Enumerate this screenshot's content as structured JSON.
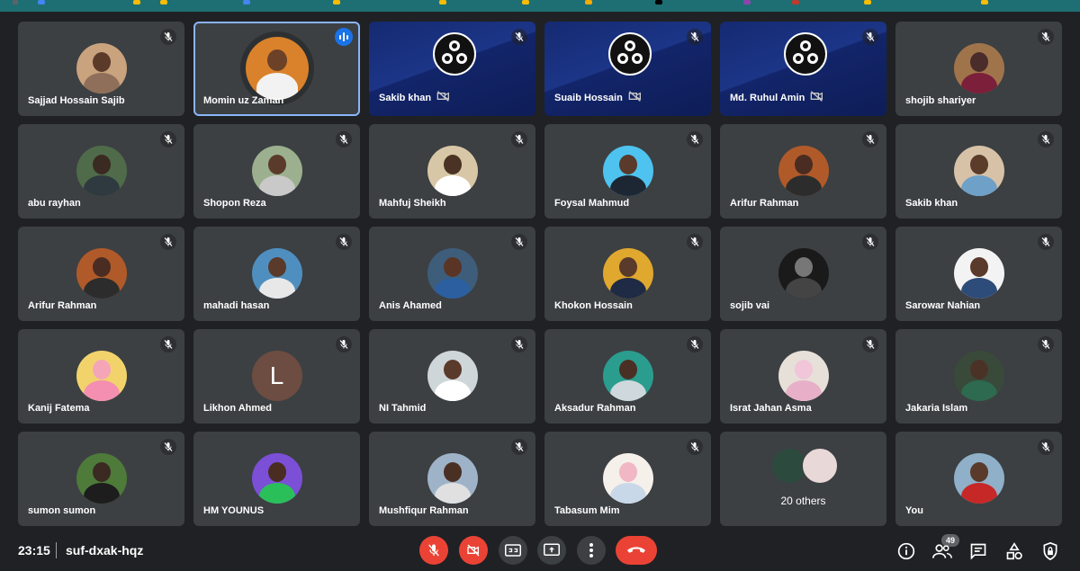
{
  "participants": [
    {
      "name": "Sajjad Hossain Sajib",
      "type": "photo",
      "bg": "#c9a27e",
      "head": "#5b3a2a",
      "body": "#8f6f5a",
      "muted": true
    },
    {
      "name": "Momin uz Zaman",
      "type": "photo-big",
      "bg": "#d9822b",
      "head": "#6b4227",
      "body": "#f2f2f2",
      "muted": false,
      "speaking": true,
      "active": true
    },
    {
      "name": "Sakib khan",
      "type": "obs",
      "muted": true,
      "cam_off": true
    },
    {
      "name": "Suaib Hossain",
      "type": "obs",
      "muted": true,
      "cam_off": true
    },
    {
      "name": "Md. Ruhul Amin",
      "type": "obs",
      "muted": true,
      "cam_off": true
    },
    {
      "name": "shojib shariyer",
      "type": "photo",
      "bg": "#a0744b",
      "head": "#4a2c2a",
      "body": "#7b1f3a",
      "muted": true
    },
    {
      "name": "abu rayhan",
      "type": "photo",
      "bg": "#4f6b4a",
      "head": "#3a2a22",
      "body": "#2e3a3f",
      "muted": true
    },
    {
      "name": "Shopon Reza",
      "type": "photo",
      "bg": "#9cb08f",
      "head": "#5a3b2a",
      "body": "#c9c9c9",
      "muted": true
    },
    {
      "name": "Mahfuj Sheikh",
      "type": "photo",
      "bg": "#d8c7a6",
      "head": "#4a3324",
      "body": "#ffffff",
      "muted": true
    },
    {
      "name": "Foysal Mahmud",
      "type": "photo",
      "bg": "#4ec3f0",
      "head": "#5a3a2a",
      "body": "#1d2733",
      "muted": true
    },
    {
      "name": "Arifur Rahman",
      "type": "photo",
      "bg": "#b05a2a",
      "head": "#4a2c22",
      "body": "#2c2c2c",
      "muted": true
    },
    {
      "name": "Sakib khan",
      "type": "photo",
      "bg": "#d7c2a8",
      "head": "#5b3b2a",
      "body": "#6fa0c8",
      "muted": true
    },
    {
      "name": "Arifur Rahman",
      "type": "photo",
      "bg": "#b05a2a",
      "head": "#4a2c22",
      "body": "#2c2c2c",
      "muted": true
    },
    {
      "name": "mahadi hasan",
      "type": "photo",
      "bg": "#4f8fc0",
      "head": "#5a3a2a",
      "body": "#e8e8e8",
      "muted": true
    },
    {
      "name": "Anis Ahamed",
      "type": "photo",
      "bg": "#3e5d7a",
      "head": "#5a3526",
      "body": "#2b5fa0",
      "muted": true
    },
    {
      "name": "Khokon Hossain",
      "type": "photo",
      "bg": "#e0a82e",
      "head": "#5a3a2a",
      "body": "#1f2a44",
      "muted": true
    },
    {
      "name": "sojib vai",
      "type": "photo",
      "bg": "#1a1a1a",
      "head": "#777777",
      "body": "#444444",
      "muted": true
    },
    {
      "name": "Sarowar Nahian",
      "type": "photo",
      "bg": "#f3f3f3",
      "head": "#5a3a2a",
      "body": "#2e4c7a",
      "muted": true
    },
    {
      "name": "Kanij Fatema",
      "type": "photo",
      "bg": "#f2d36b",
      "head": "#f4a6b8",
      "body": "#f48fb1",
      "muted": true
    },
    {
      "name": "Likhon Ahmed",
      "type": "letter",
      "letter": "L",
      "muted": true
    },
    {
      "name": "NI Tahmid",
      "type": "photo",
      "bg": "#cfd6d9",
      "head": "#5a3a2a",
      "body": "#ffffff",
      "muted": true
    },
    {
      "name": "Aksadur Rahman",
      "type": "photo",
      "bg": "#2a9d8f",
      "head": "#4a3024",
      "body": "#cfd8dc",
      "muted": true
    },
    {
      "name": "Israt Jahan Asma",
      "type": "photo",
      "bg": "#e6e0d8",
      "head": "#f0c6d8",
      "body": "#e8b0c8",
      "muted": true
    },
    {
      "name": "Jakaria Islam",
      "type": "photo",
      "bg": "#3a4a3a",
      "head": "#4a3326",
      "body": "#2d6a4f",
      "muted": true
    },
    {
      "name": "sumon sumon",
      "type": "photo",
      "bg": "#4e7a3a",
      "head": "#3a2a22",
      "body": "#1d1d1d",
      "muted": true
    },
    {
      "name": "HM YOUNUS",
      "type": "photo",
      "bg": "#7b4fd6",
      "head": "#4a2c22",
      "body": "#2bbf5a",
      "muted": false
    },
    {
      "name": "Mushfiqur Rahman",
      "type": "photo",
      "bg": "#9fb3c8",
      "head": "#4a3024",
      "body": "#e0e0e0",
      "muted": true
    },
    {
      "name": "Tabasum Mim",
      "type": "photo",
      "bg": "#f5f0ea",
      "head": "#f1b7c4",
      "body": "#c9d8e8",
      "muted": true
    },
    {
      "name": "",
      "type": "others",
      "others_label": "20 others"
    },
    {
      "name": "You",
      "type": "photo",
      "bg": "#8fb0c8",
      "head": "#5a3a2a",
      "body": "#c62828",
      "muted": true
    }
  ],
  "others_avatar_colors": [
    "#2d4a3e",
    "#e8d8d8"
  ],
  "meeting": {
    "time": "23:15",
    "code": "suf-dxak-hqz",
    "participant_count": "49"
  },
  "colors": {
    "background": "#202124",
    "tile": "#3c4043",
    "accent": "#8ab4f8",
    "danger": "#ea4335"
  }
}
